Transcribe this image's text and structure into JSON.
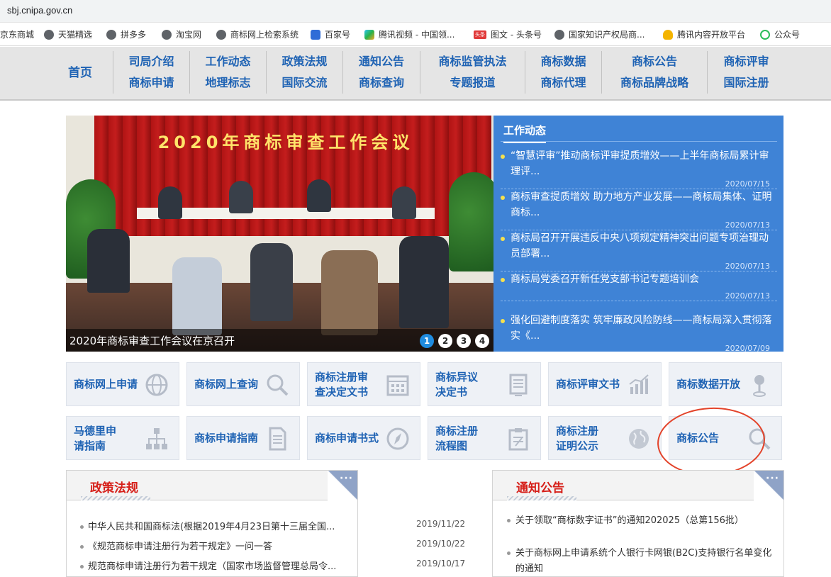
{
  "browser": {
    "url": "sbj.cnipa.gov.cn",
    "bookmarks": [
      {
        "label": "京东商城",
        "icon": "none"
      },
      {
        "label": "天猫精选",
        "icon": "globe-icon"
      },
      {
        "label": "拼多多",
        "icon": "globe-icon"
      },
      {
        "label": "淘宝网",
        "icon": "globe-icon"
      },
      {
        "label": "商标网上检索系统",
        "icon": "globe-icon"
      },
      {
        "label": "百家号",
        "icon": "baidu-icon"
      },
      {
        "label": "腾讯视频 - 中国领...",
        "icon": "tencent-video-icon"
      },
      {
        "label": "图文 - 头条号",
        "icon": "toutiao-icon"
      },
      {
        "label": "国家知识产权局商...",
        "icon": "globe-icon"
      },
      {
        "label": "腾讯内容开放平台",
        "icon": "bell-icon"
      },
      {
        "label": "公众号",
        "icon": "wechat-icon"
      }
    ],
    "toutiao_badge": "头条"
  },
  "nav": {
    "home": "首页",
    "columns": [
      [
        "司局介绍",
        "商标申请"
      ],
      [
        "工作动态",
        "地理标志"
      ],
      [
        "政策法规",
        "国际交流"
      ],
      [
        "通知公告",
        "商标查询"
      ],
      [
        "商标监管执法",
        "专题报道"
      ],
      [
        "商标数据",
        "商标代理"
      ],
      [
        "商标公告",
        "商标品牌战略"
      ],
      [
        "商标评审",
        "国际注册"
      ]
    ]
  },
  "banner": {
    "hall_title": "2020年商标审查工作会议",
    "caption": "2020年商标审查工作会议在京召开",
    "pages": [
      "1",
      "2",
      "3",
      "4"
    ],
    "active_page": 1
  },
  "work_news": {
    "title": "工作动态",
    "items": [
      {
        "title": "“智慧评审”推动商标评审提质增效——上半年商标局累计审理评...",
        "date": "2020/07/15"
      },
      {
        "title": "商标审查提质增效 助力地方产业发展——商标局集体、证明商标...",
        "date": "2020/07/13"
      },
      {
        "title": "商标局召开开展违反中央八项规定精神突出问题专项治理动员部署...",
        "date": "2020/07/13"
      },
      {
        "title": "商标局党委召开新任党支部书记专题培训会",
        "date": "2020/07/13"
      },
      {
        "title": "强化回避制度落实 筑牢廉政风险防线——商标局深入贯彻落实《...",
        "date": "2020/07/09"
      }
    ]
  },
  "quick_links": [
    {
      "label": [
        "商标网上申请"
      ],
      "icon": "globe-icon"
    },
    {
      "label": [
        "商标网上查询"
      ],
      "icon": "magnifier-icon"
    },
    {
      "label": [
        "商标注册审",
        "查决定文书"
      ],
      "icon": "calendar-icon"
    },
    {
      "label": [
        "商标异议",
        "决定书"
      ],
      "icon": "document-icon"
    },
    {
      "label": [
        "商标评审文书"
      ],
      "icon": "bar-chart-icon"
    },
    {
      "label": [
        "商标数据开放"
      ],
      "icon": "location-pin-icon"
    },
    {
      "label": [
        "马德里申",
        "请指南"
      ],
      "icon": "org-chart-icon"
    },
    {
      "label": [
        "商标申请指南"
      ],
      "icon": "file-icon"
    },
    {
      "label": [
        "商标申请书式"
      ],
      "icon": "compass-icon"
    },
    {
      "label": [
        "商标注册",
        "流程图"
      ],
      "icon": "clipboard-icon"
    },
    {
      "label": [
        "商标注册",
        "证明公示"
      ],
      "icon": "globe-icon"
    },
    {
      "label": [
        "商标公告"
      ],
      "icon": "magnifier-icon"
    }
  ],
  "policy": {
    "title": "政策法规",
    "more": "···",
    "items": [
      {
        "title": "中华人民共和国商标法(根据2019年4月23日第十三届全国...",
        "date": "2019/11/22"
      },
      {
        "title": "《规范商标申请注册行为若干规定》一问一答",
        "date": "2019/10/22"
      },
      {
        "title": "规范商标申请注册行为若干规定（国家市场监督管理总局令...",
        "date": "2019/10/17"
      }
    ]
  },
  "notice": {
    "title": "通知公告",
    "more": "···",
    "items": [
      {
        "title": "关于领取“商标数字证书”的通知202025（总第156批）"
      },
      {
        "title": "关于商标网上申请系统个人银行卡网银(B2C)支持银行名单变化的通知"
      }
    ]
  },
  "colors": {
    "nav_text": "#1f63b4",
    "news_bg": "#3f83d6",
    "panel_title": "#d6201a",
    "annotation_circle": "#e3432a"
  }
}
